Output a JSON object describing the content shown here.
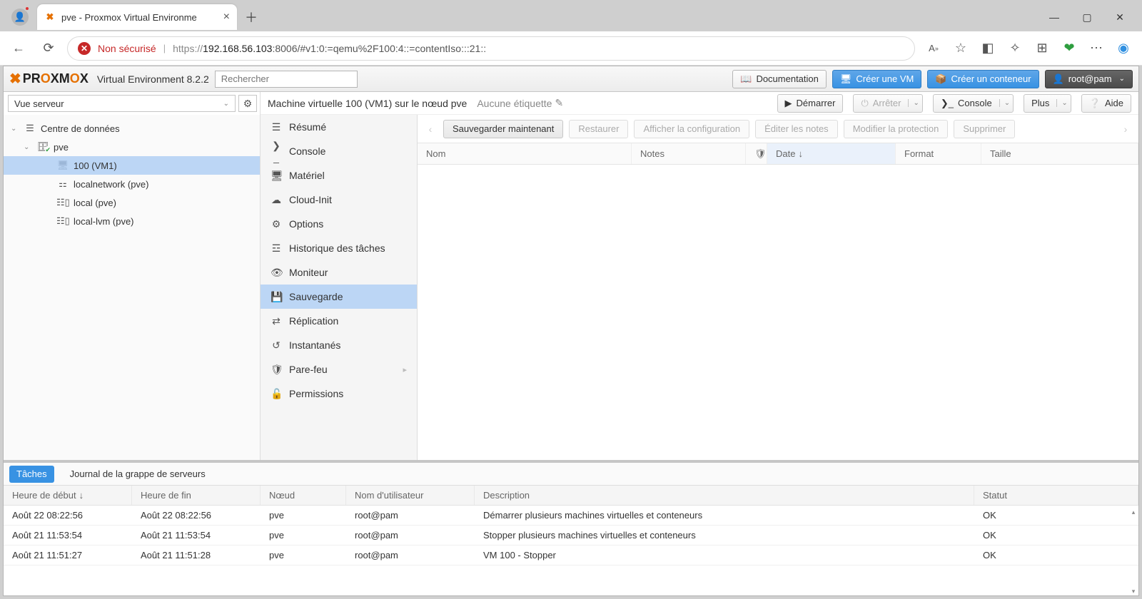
{
  "browser": {
    "tab_title": "pve - Proxmox Virtual Environme",
    "nonsecure": "Non sécurisé",
    "url_proto": "https://",
    "url_host": "192.168.56.103",
    "url_rest": ":8006/#v1:0:=qemu%2F100:4::=contentIso:::21::"
  },
  "header": {
    "env": "Virtual Environment 8.2.2",
    "search_placeholder": "Rechercher",
    "btn_docs": "Documentation",
    "btn_create_vm": "Créer une VM",
    "btn_create_ct": "Créer un conteneur",
    "btn_user": "root@pam"
  },
  "row2": {
    "view": "Vue serveur",
    "crumb": "Machine virtuelle 100 (VM1) sur le nœud pve",
    "tags": "Aucune étiquette",
    "btn_start": "Démarrer",
    "btn_stop": "Arrêter",
    "btn_console": "Console",
    "btn_more": "Plus",
    "btn_help": "Aide"
  },
  "tree": {
    "root": "Centre de données",
    "node": "pve",
    "vm": "100 (VM1)",
    "net": "localnetwork (pve)",
    "local": "local (pve)",
    "lvm": "local-lvm (pve)"
  },
  "sidemenu": {
    "summary": "Résumé",
    "console": "Console",
    "hardware": "Matériel",
    "cloudinit": "Cloud-Init",
    "options": "Options",
    "taskhist": "Historique des tâches",
    "monitor": "Moniteur",
    "backup": "Sauvegarde",
    "replication": "Réplication",
    "snapshots": "Instantanés",
    "firewall": "Pare-feu",
    "permissions": "Permissions"
  },
  "toolbar2": {
    "backup_now": "Sauvegarder maintenant",
    "restore": "Restaurer",
    "show_config": "Afficher la configuration",
    "edit_notes": "Éditer les notes",
    "protect": "Modifier la protection",
    "delete": "Supprimer"
  },
  "grid": {
    "name": "Nom",
    "notes": "Notes",
    "date": "Date",
    "format": "Format",
    "size": "Taille"
  },
  "tasks": {
    "tab_tasks": "Tâches",
    "tab_log": "Journal de la grappe de serveurs",
    "col_start": "Heure de début",
    "col_end": "Heure de fin",
    "col_node": "Nœud",
    "col_user": "Nom d'utilisateur",
    "col_desc": "Description",
    "col_status": "Statut",
    "rows": [
      {
        "start": "Août 22 08:22:56",
        "end": "Août 22 08:22:56",
        "node": "pve",
        "user": "root@pam",
        "desc": "Démarrer plusieurs machines virtuelles et conteneurs",
        "status": "OK"
      },
      {
        "start": "Août 21 11:53:54",
        "end": "Août 21 11:53:54",
        "node": "pve",
        "user": "root@pam",
        "desc": "Stopper plusieurs machines virtuelles et conteneurs",
        "status": "OK"
      },
      {
        "start": "Août 21 11:51:27",
        "end": "Août 21 11:51:28",
        "node": "pve",
        "user": "root@pam",
        "desc": "VM 100 - Stopper",
        "status": "OK"
      }
    ]
  }
}
